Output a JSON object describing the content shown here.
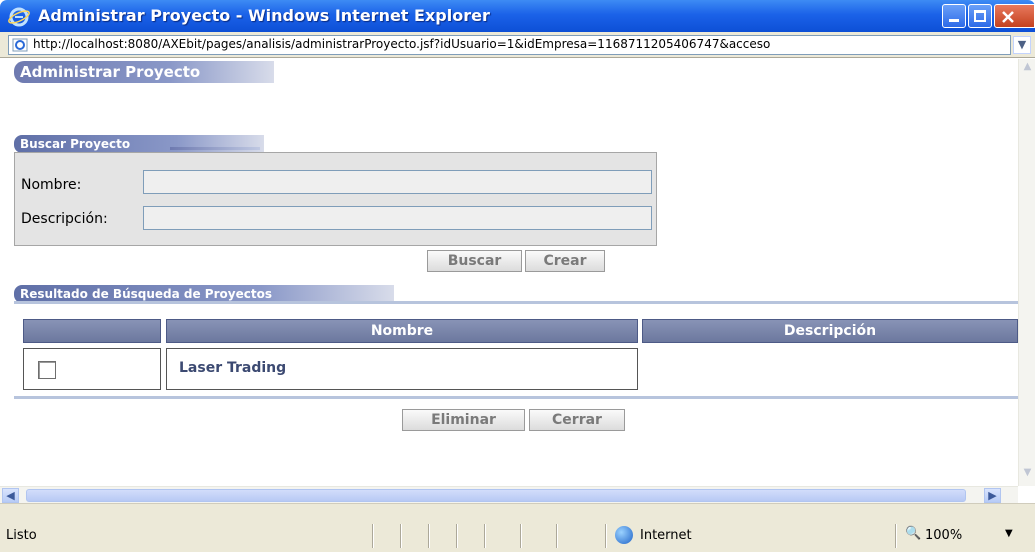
{
  "window": {
    "title": "Administrar Proyecto - Windows Internet Explorer",
    "url": "http://localhost:8080/AXEbit/pages/analisis/administrarProyecto.jsf?idUsuario=1&idEmpresa=1168711205406747&acceso"
  },
  "page": {
    "title": "Administrar Proyecto",
    "search_section": "Buscar Proyecto",
    "nombre_label": "Nombre:",
    "descripcion_label": "Descripción:",
    "nombre_value": "",
    "descripcion_value": "",
    "buscar_button": "Buscar",
    "crear_button": "Crear",
    "results_section": "Resultado de Búsqueda de Proyectos",
    "columns": [
      "",
      "Nombre",
      "Descripción"
    ],
    "rows": [
      {
        "nombre": "Laser Trading",
        "descripcion": ""
      }
    ],
    "eliminar_button": "Eliminar",
    "cerrar_button": "Cerrar"
  },
  "statusbar": {
    "status": "Listo",
    "zone": "Internet",
    "zoom": "100%"
  },
  "colors": {
    "titlebar": "#1b62e8",
    "section_header": "#6e7ab0",
    "table_header": "#7a86ab"
  }
}
